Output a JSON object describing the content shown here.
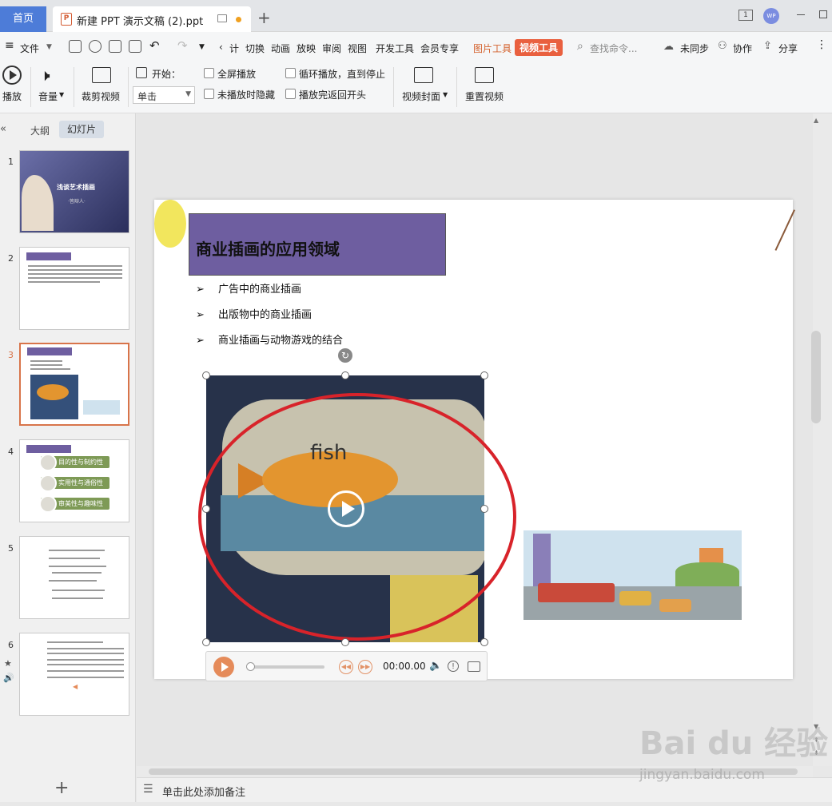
{
  "tabs": {
    "home": "首页",
    "document": "新建 PPT 演示文稿 (2).ppt"
  },
  "menu": {
    "file": "文件",
    "items": [
      "计",
      "切换",
      "动画",
      "放映",
      "审阅",
      "视图",
      "开发工具",
      "会员专享"
    ],
    "picture_tools": "图片工具",
    "video_tools": "视频工具",
    "search_placeholder": "查找命令...",
    "unsynced": "未同步",
    "collaborate": "协作",
    "share": "分享"
  },
  "ribbon": {
    "play": "播放",
    "volume": "音量",
    "trim": "裁剪视频",
    "start_label": "开始：",
    "start_value": "单击",
    "fullscreen": "全屏播放",
    "hide_when_not_playing": "未播放时隐藏",
    "loop": "循环播放，直到停止",
    "rewind": "播放完返回开头",
    "cover": "视频封面",
    "reset": "重置视频"
  },
  "left_panel": {
    "tab_outline": "大纲",
    "tab_slides": "幻灯片",
    "slide_numbers": [
      "1",
      "2",
      "3",
      "4",
      "5",
      "6"
    ],
    "thumb1_title": "浅谈艺术插画",
    "thumb1_sub": "·答辩人·",
    "thumb4_items": [
      "目的性与制约性",
      "实用性与通俗性",
      "审美性与趣味性"
    ]
  },
  "slide": {
    "title": "商业插画的应用领域",
    "bullets": [
      "广告中的商业插画",
      "出版物中的商业插画",
      "商业插画与动物游戏的结合"
    ],
    "video_text": "fish"
  },
  "player": {
    "time": "00:00.00"
  },
  "notes_placeholder": "单击此处添加备注",
  "watermark": "Bai du 经验",
  "watermark_url": "jingyan.baidu.com",
  "colors": {
    "accent_tab": "#4d7cd8",
    "video_tool_tab": "#e9603f",
    "title_box": "#6e5ea0",
    "highlight_ellipse": "#d8232a"
  }
}
